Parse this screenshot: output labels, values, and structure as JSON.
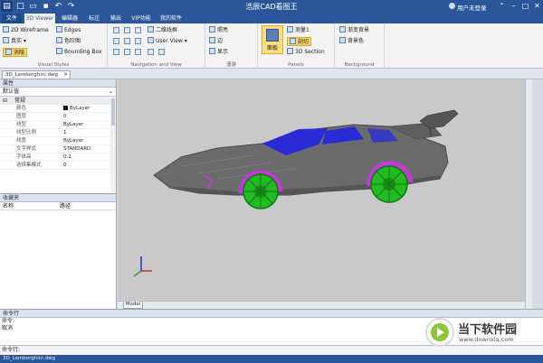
{
  "app": {
    "title": "浩辰CAD看图王",
    "user_login": "用户未登录"
  },
  "quick_access": [
    "app-menu-icon",
    "new-icon",
    "open-icon",
    "save-icon",
    "undo-icon",
    "redo-icon"
  ],
  "tabs": [
    {
      "label": "文件",
      "active": false
    },
    {
      "label": "3D Viewer",
      "active": true
    },
    {
      "label": "编辑器",
      "active": false
    },
    {
      "label": "标注",
      "active": false
    },
    {
      "label": "输出",
      "active": false
    },
    {
      "label": "VIP功能",
      "active": false
    },
    {
      "label": "我的软件",
      "active": false
    }
  ],
  "ribbon": {
    "visual_styles": {
      "label": "Visual Styles",
      "items": [
        "2D Wireframe",
        "真实",
        "消隐",
        "Edges",
        "色阶图",
        "Bounding Box"
      ]
    },
    "navigation": {
      "label": "Navigation and View",
      "items": [
        "二维线框",
        "User View"
      ]
    },
    "walk": {
      "label": "漫游",
      "items": [
        "照亮",
        "边",
        "显示"
      ]
    },
    "panels": {
      "label": "Panels",
      "items": [
        "面板",
        "测量1",
        "剖切",
        "3D Section"
      ]
    },
    "background": {
      "label": "Background",
      "items": [
        "渐变背景",
        "背景色"
      ]
    }
  },
  "document": {
    "tab_label": "3D_Lamborghini.dwg"
  },
  "properties": {
    "title": "属性",
    "layer_select": "默认值",
    "category": "常规",
    "rows": [
      {
        "key": "颜色",
        "value": "ByLayer",
        "swatch": "#111111"
      },
      {
        "key": "图层",
        "value": "0"
      },
      {
        "key": "线型",
        "value": "ByLayer"
      },
      {
        "key": "线型比例",
        "value": "1"
      },
      {
        "key": "线宽",
        "value": "ByLayer"
      },
      {
        "key": "文字样式",
        "value": "STANDARD"
      },
      {
        "key": "字体高",
        "value": "0.2"
      },
      {
        "key": "选择集模式",
        "value": "0"
      }
    ]
  },
  "favorites": {
    "title": "收藏夹",
    "col_name": "名称",
    "col_path": "路径"
  },
  "viewport": {
    "background": "#c9c9c9",
    "model_tab": "Model"
  },
  "command": {
    "title": "命令行",
    "lines": [
      "命令:",
      "取消"
    ],
    "input_label": "命令行:"
  },
  "status": {
    "text": "3D_Lamborghini.dwg"
  },
  "watermark": {
    "title": "当下软件园",
    "url": "www.downxia.com"
  },
  "colors": {
    "title_bar": "#2b579a",
    "ribbon_bg": "#f3f3f3",
    "car_body": "#6b6b6b",
    "car_window": "#2a2ad6",
    "car_wheel": "#22bb22",
    "car_arch": "#c23ad6"
  }
}
